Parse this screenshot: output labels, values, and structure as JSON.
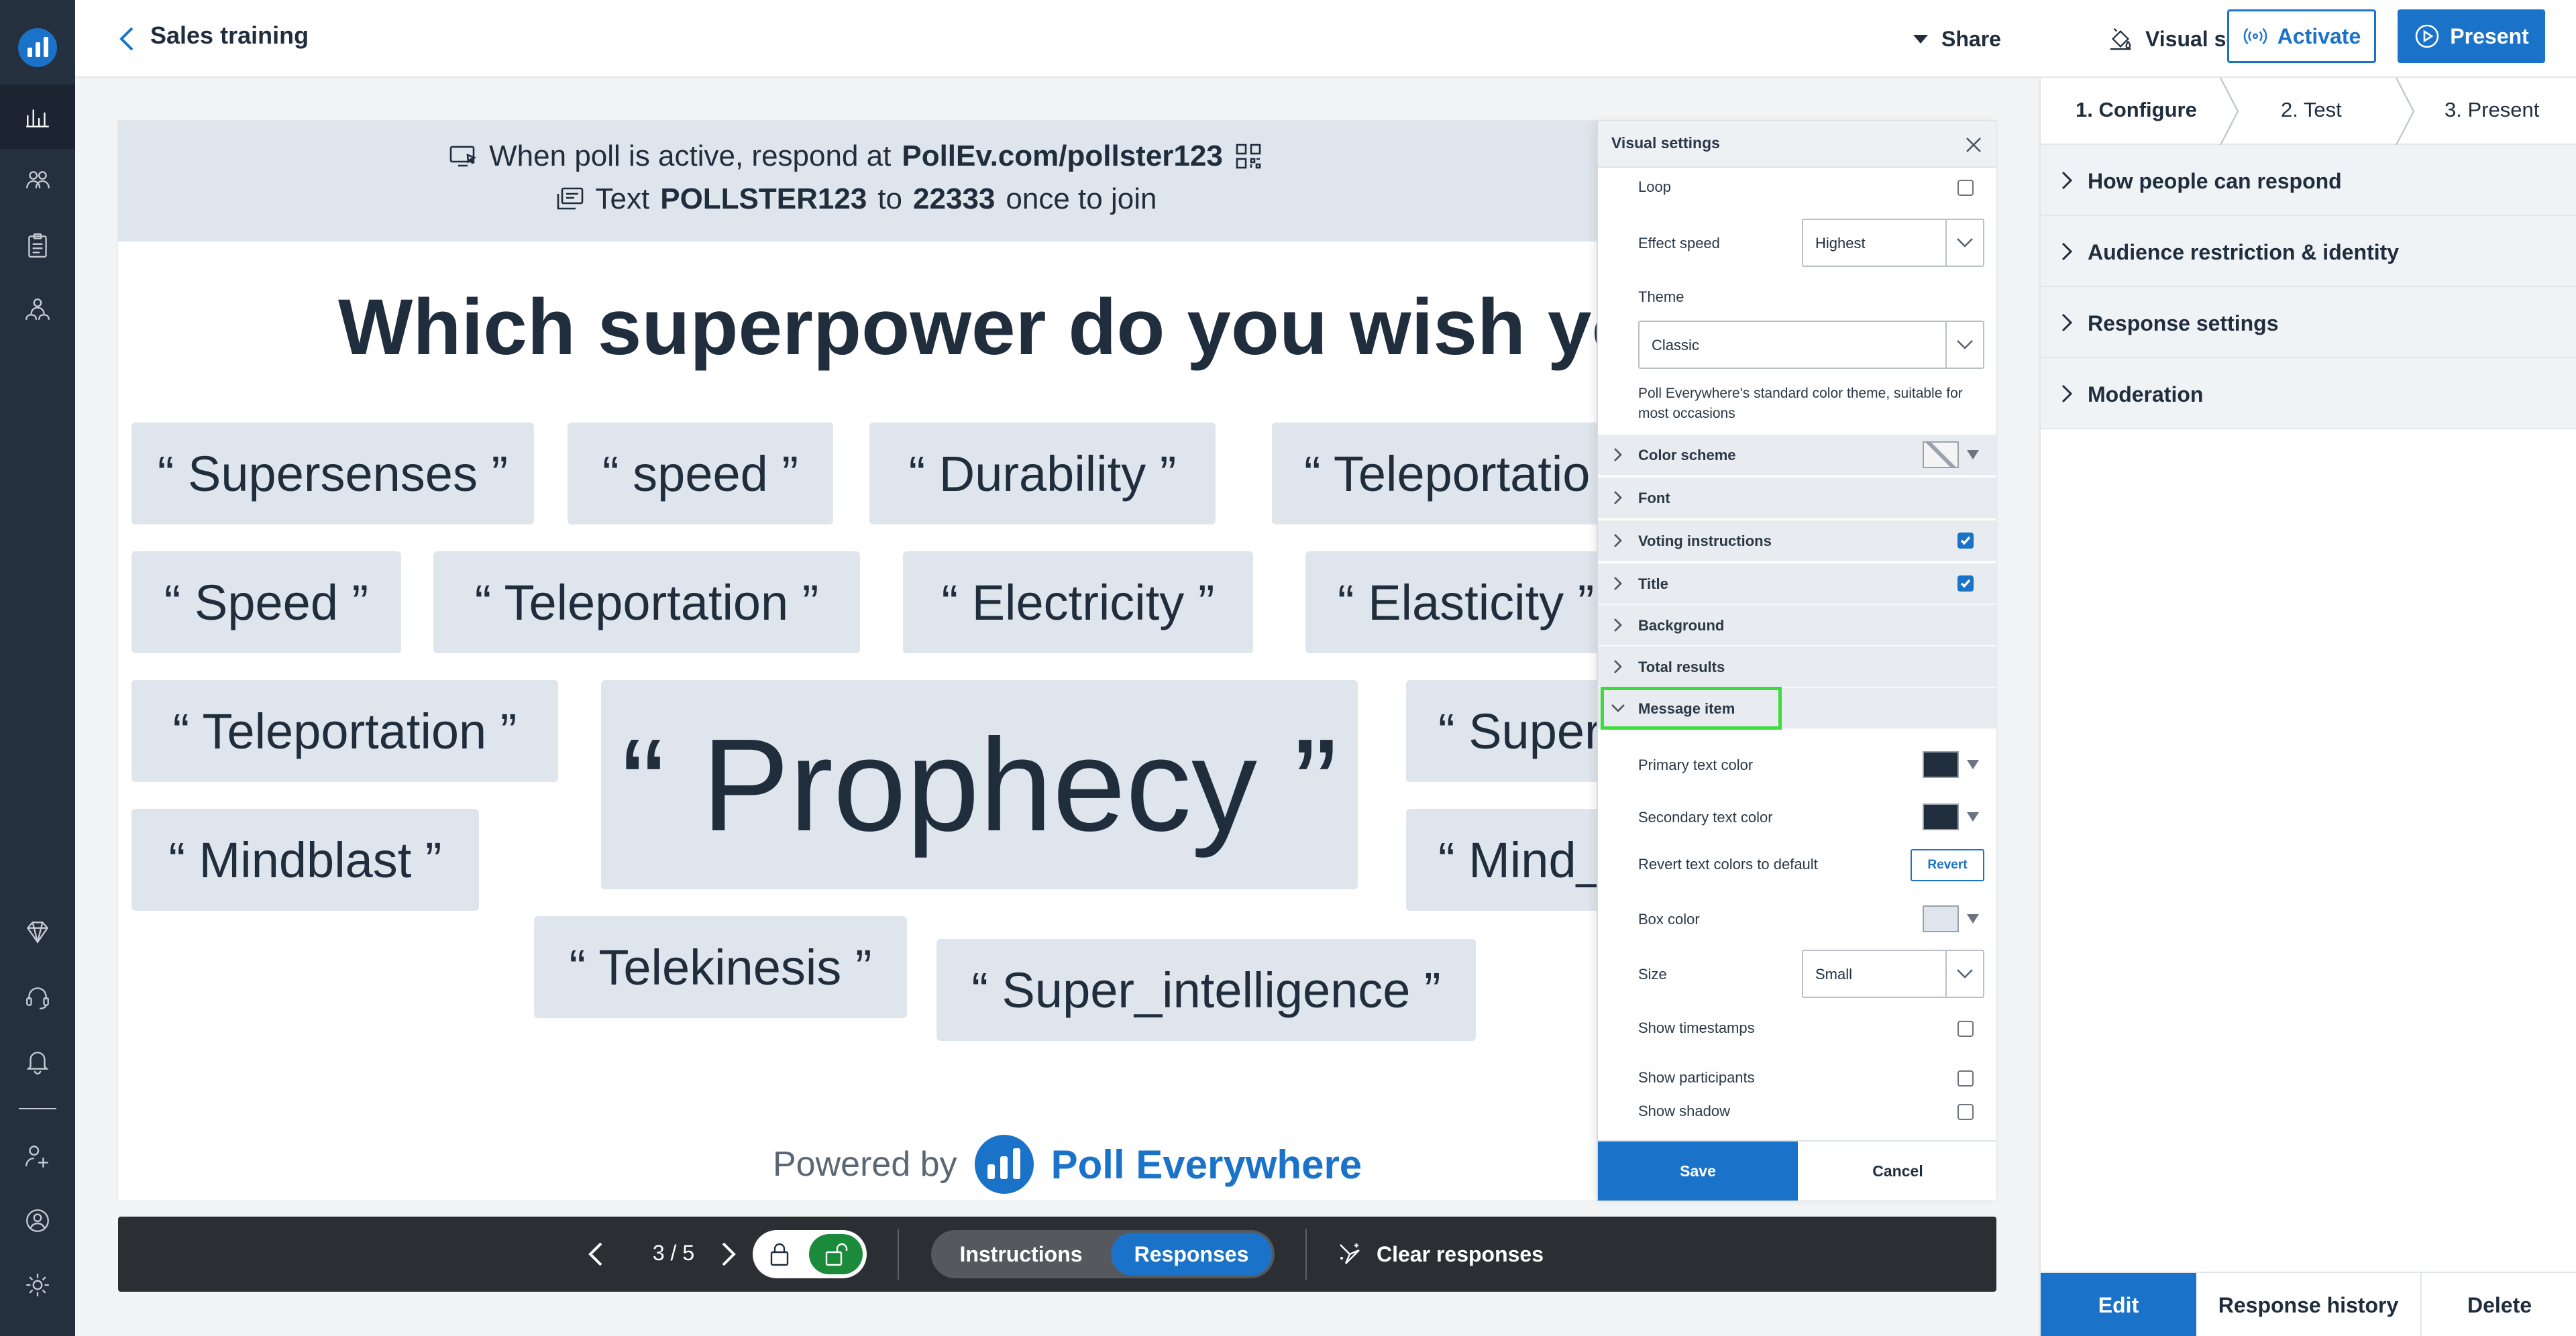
{
  "topbar": {
    "title": "Sales training",
    "share_label": "Share",
    "visual_settings_label": "Visual settings",
    "activate_label": "Activate",
    "present_label": "Present"
  },
  "slide": {
    "instruction_web_prefix": "When poll is active, respond at",
    "instruction_web_url": "PollEv.com/pollster123",
    "instruction_text_prefix": "Text",
    "instruction_text_code": "POLLSTER123",
    "instruction_text_to": "to",
    "instruction_text_number": "22333",
    "instruction_text_suffix": "once to join",
    "title": "Which superpower do you wish you",
    "responses": [
      "“ Supersenses ”",
      "“ speed ”",
      "“ Durability ”",
      "“ Teleportatio",
      "“ Speed ”",
      "“ Teleportation ”",
      "“ Electricity ”",
      "“ Elasticity ”",
      "“ Teleportation ”",
      "“ Prophecy ”",
      "“ Super",
      "“ Mindblast ”",
      "“ Mind_",
      "“ Telekinesis ”",
      "“ Super_intelligence ”"
    ],
    "powered_by": "Powered by",
    "brand_name": "Poll Everywhere"
  },
  "controls": {
    "slide_counter": "3 / 5",
    "instructions_label": "Instructions",
    "responses_label": "Responses",
    "clear_label": "Clear responses"
  },
  "visual_settings": {
    "title": "Visual settings",
    "loop_label": "Loop",
    "effect_speed_label": "Effect speed",
    "effect_speed_value": "Highest",
    "theme_label": "Theme",
    "theme_value": "Classic",
    "theme_description": "Poll Everywhere's standard color theme, suitable for most occasions",
    "sections": {
      "color_scheme": "Color scheme",
      "font": "Font",
      "voting_instructions": "Voting instructions",
      "title": "Title",
      "background": "Background",
      "total_results": "Total results",
      "message_item": "Message item"
    },
    "message_item": {
      "primary_text_color_label": "Primary text color",
      "primary_text_color": "#1f2d3d",
      "secondary_text_color_label": "Secondary text color",
      "secondary_text_color": "#1f2d3d",
      "revert_label": "Revert text colors to default",
      "revert_button": "Revert",
      "box_color_label": "Box color",
      "box_color": "#dfe5ec",
      "size_label": "Size",
      "size_value": "Small",
      "show_timestamps_label": "Show timestamps",
      "show_participants_label": "Show participants",
      "show_shadow_label": "Show shadow"
    },
    "save_label": "Save",
    "cancel_label": "Cancel"
  },
  "right_panel": {
    "steps": [
      "1. Configure",
      "2. Test",
      "3. Present"
    ],
    "sections": [
      "How people can respond",
      "Audience restriction & identity",
      "Response settings",
      "Moderation"
    ],
    "edit_label": "Edit",
    "history_label": "Response history",
    "delete_label": "Delete"
  },
  "colors": {
    "accent": "#1a73c8",
    "nav_bg": "#25303f",
    "highlight": "#3ddc3d",
    "unlocked_green": "#1b8a3a"
  }
}
